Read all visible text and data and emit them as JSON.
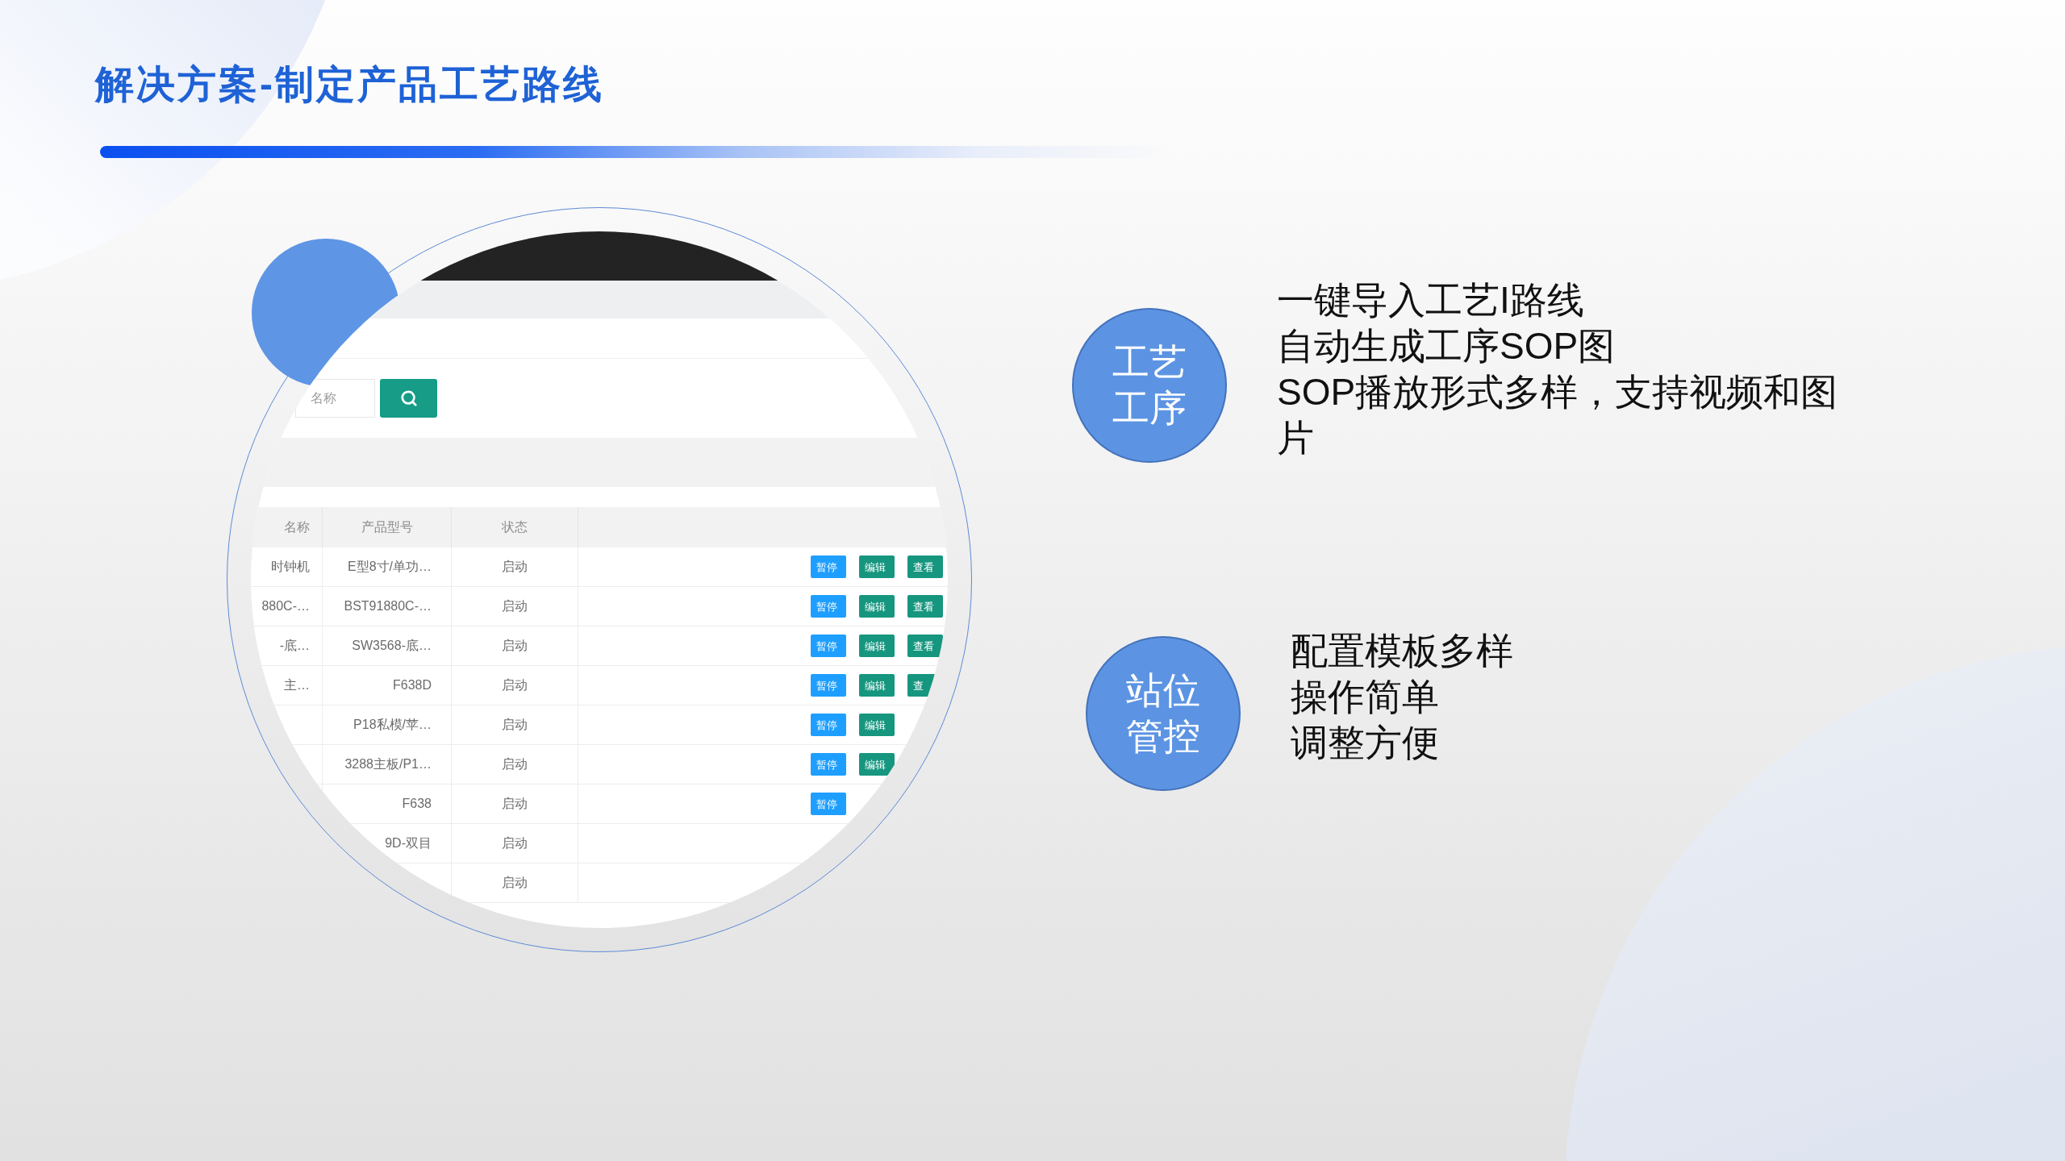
{
  "title": "解决方案-制定产品工艺路线",
  "screenshot": {
    "search": {
      "placeholder": "名称"
    },
    "table": {
      "columns": [
        "名称",
        "产品型号",
        "状态"
      ],
      "rows": [
        {
          "name": "时钟机",
          "model": "E型8寸/单功…",
          "status": "启动",
          "actions": [
            {
              "kind": "pause",
              "label": "暂停"
            },
            {
              "kind": "edit",
              "label": "编辑"
            },
            {
              "kind": "view",
              "label": "查看"
            }
          ]
        },
        {
          "name": "880C-…",
          "model": "BST91880C-…",
          "status": "启动",
          "actions": [
            {
              "kind": "pause",
              "label": "暂停"
            },
            {
              "kind": "edit",
              "label": "编辑"
            },
            {
              "kind": "view",
              "label": "查看"
            }
          ]
        },
        {
          "name": "-底…",
          "model": "SW3568-底…",
          "status": "启动",
          "actions": [
            {
              "kind": "pause",
              "label": "暂停"
            },
            {
              "kind": "edit",
              "label": "编辑"
            },
            {
              "kind": "view",
              "label": "查看"
            }
          ]
        },
        {
          "name": "主…",
          "model": "F638D",
          "status": "启动",
          "actions": [
            {
              "kind": "pause",
              "label": "暂停"
            },
            {
              "kind": "edit",
              "label": "编辑"
            },
            {
              "kind": "view",
              "label": "查"
            }
          ]
        },
        {
          "model": "P18私模/苹…",
          "status": "启动",
          "actions": [
            {
              "kind": "pause",
              "label": "暂停"
            },
            {
              "kind": "edit",
              "label": "编辑"
            }
          ]
        },
        {
          "model": "3288主板/P1…",
          "status": "启动",
          "actions": [
            {
              "kind": "pause",
              "label": "暂停"
            },
            {
              "kind": "edit",
              "label": "编辑"
            }
          ]
        },
        {
          "model": "F638",
          "status": "启动",
          "actions": [
            {
              "kind": "pause",
              "label": "暂停"
            }
          ]
        },
        {
          "model": "9D-双目",
          "status": "启动"
        },
        {
          "status": "启动"
        }
      ]
    }
  },
  "features": [
    {
      "badge": "工艺工序",
      "lines": [
        "一键导入工艺I路线",
        "自动生成工序SOP图",
        "SOP播放形式多样，支持视频和图片"
      ]
    },
    {
      "badge": "站位管控",
      "lines": [
        "配置模板多样",
        "操作简单",
        "调整方便"
      ]
    }
  ]
}
